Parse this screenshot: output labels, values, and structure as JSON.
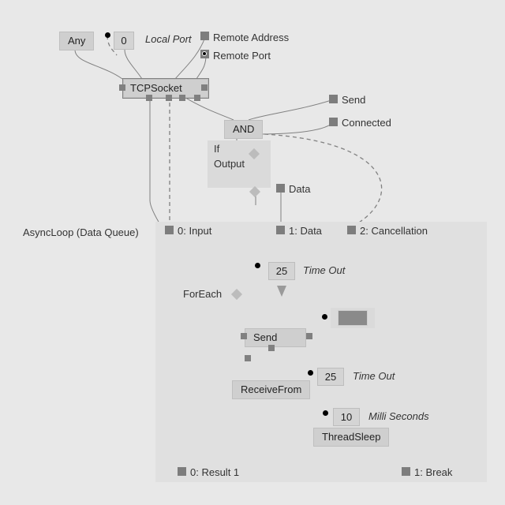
{
  "nodes": {
    "any": "Any",
    "zero": "0",
    "tcpsocket": "TCPSocket",
    "and": "AND",
    "send_small": "Send",
    "receive": "ReceiveFrom",
    "threadsleep": "ThreadSleep"
  },
  "values": {
    "timeout1": "25",
    "timeout2": "25",
    "millis": "10"
  },
  "labels": {
    "localport": "Local Port",
    "remoteaddress": "Remote Address",
    "remoteport": "Remote Port",
    "send": "Send",
    "connected": "Connected",
    "if": "If",
    "output": "Output",
    "data": "Data",
    "asyncloop": "AsyncLoop (Data Queue)",
    "in0": "0:  Input",
    "in1": "1:  Data",
    "in2": "2:  Cancellation",
    "foreach": "ForEach",
    "timeout": "Time Out",
    "milliseconds": "Milli Seconds",
    "out0": "0:  Result 1",
    "out1": "1:  Break"
  }
}
